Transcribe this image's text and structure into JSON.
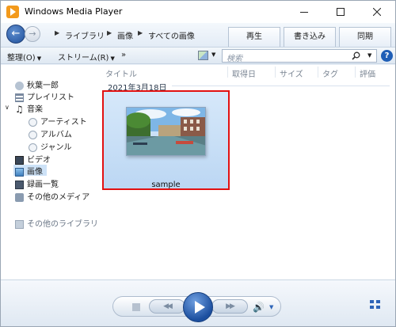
{
  "window": {
    "title": "Windows Media Player"
  },
  "nav": {
    "back_glyph": "←",
    "forward_glyph": "→",
    "breadcrumb": [
      "ライブラリ",
      "画像",
      "すべての画像"
    ],
    "crumb_sep": "▶"
  },
  "tabs": [
    "再生",
    "書き込み",
    "同期"
  ],
  "toolbar": {
    "organize": "整理(O)",
    "stream": "ストリーム(R)",
    "more": "»",
    "search_placeholder": "検索",
    "help": "?"
  },
  "sidebar": {
    "items": [
      {
        "label": "秋葉一郎",
        "icon": "user-icon"
      },
      {
        "label": "プレイリスト",
        "icon": "playlist-icon"
      },
      {
        "label": "音楽",
        "icon": "music-icon"
      },
      {
        "label": "アーティスト",
        "icon": "artist-icon"
      },
      {
        "label": "アルバム",
        "icon": "album-icon"
      },
      {
        "label": "ジャンル",
        "icon": "genre-icon"
      },
      {
        "label": "ビデオ",
        "icon": "video-icon"
      },
      {
        "label": "画像",
        "icon": "picture-icon",
        "selected": true
      },
      {
        "label": "録画一覧",
        "icon": "recorded-tv-icon"
      },
      {
        "label": "その他のメディア",
        "icon": "other-media-icon"
      },
      {
        "label": "その他のライブラリ",
        "icon": "other-libraries-icon"
      }
    ]
  },
  "main": {
    "columns": [
      "タイトル",
      "取得日",
      "サイズ",
      "タグ",
      "評価"
    ],
    "date_group": "2021年3月18日",
    "items": [
      {
        "caption": "sample"
      }
    ]
  },
  "player": {
    "stop": "stop-icon",
    "previous": "◀◀",
    "play": "play-icon",
    "next": "▶▶",
    "volume": "🔊"
  },
  "colors": {
    "accent": "#1f5eb6",
    "selection": "#cde2f7",
    "highlight_border": "#e21111"
  }
}
